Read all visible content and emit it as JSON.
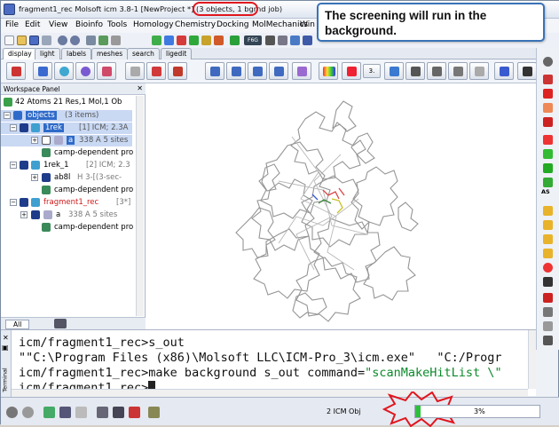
{
  "window": {
    "title": "fragment1_rec Molsoft icm 3.8-1  [NewProject *] (3 objects, 1 bgrnd job)"
  },
  "menu": [
    "File",
    "Edit",
    "View",
    "Bioinfo",
    "Tools",
    "Homology",
    "Chemistry",
    "Docking",
    "MolMechanics",
    "Win"
  ],
  "tabs": [
    "display",
    "light",
    "labels",
    "meshes",
    "search",
    "ligedit"
  ],
  "toolbar": {
    "fg_label": "F6G",
    "ab_label": "AS",
    "spin_value": "3."
  },
  "callout": {
    "text": "The screening will run in the background."
  },
  "workspace": {
    "title": "Workspace Panel",
    "summary": "42 Atoms 21 Res,1 Mol,1 Ob",
    "items": [
      {
        "label": "objects",
        "extra": "(3 items)",
        "level": 0
      },
      {
        "label": "1rek",
        "extra": "[1] ICM; 2.3A",
        "level": 1
      },
      {
        "label": "a",
        "extra": "338 A  5 sites",
        "level": 2
      },
      {
        "label": "camp-dependent pro",
        "extra": "",
        "level": 2
      },
      {
        "label": "1rek_1",
        "extra": "[2] ICM; 2.3",
        "level": 1
      },
      {
        "label": "ab8l",
        "extra": "H  3-[(3-sec-",
        "level": 2
      },
      {
        "label": "camp-dependent pro",
        "extra": "",
        "level": 2
      },
      {
        "label": "fragment1_rec",
        "extra": "[3*]",
        "level": 1
      },
      {
        "label": "a",
        "extra": "338 A  5 sites",
        "level": 2
      },
      {
        "label": "camp-dependent pro",
        "extra": "",
        "level": 2
      }
    ],
    "bottom_tab": "All"
  },
  "terminal": {
    "side_label": "Terminal",
    "lines": [
      {
        "text": "icm/fragment1_rec>s_out"
      },
      {
        "text": "\"\"C:\\Program Files (x86)\\Molsoft LLC\\ICM-Pro_3\\icm.exe\"   \"C:/Progr"
      },
      {
        "text": "icm/fragment1_rec>make background s_out command=",
        "str": "\"scanMakeHitList \\\""
      },
      {
        "text": "icm/fragment1_rec>"
      }
    ]
  },
  "status": {
    "obj_count": "2 ICM Obj",
    "progress_label": "3%",
    "progress": 0.03
  },
  "colors": {
    "accent": "#3a72b6",
    "highlight": "#e0161e",
    "selection": "#2e6ac9",
    "progress_fill": "#2fbf3f"
  }
}
